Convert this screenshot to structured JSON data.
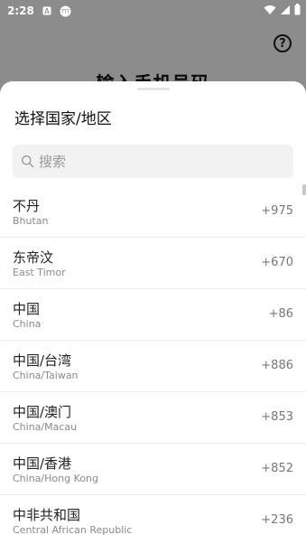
{
  "status_bar": {
    "time": "2:28",
    "icons": [
      "notification-a-icon",
      "notification-ttt-icon",
      "wifi-icon",
      "signal-icon",
      "battery-icon"
    ]
  },
  "background": {
    "title": "输入手机号码"
  },
  "sheet": {
    "title": "选择国家/地区",
    "search": {
      "placeholder": "搜索"
    },
    "countries": [
      {
        "name": "不丹",
        "english": "Bhutan",
        "code": "+975"
      },
      {
        "name": "东帝汶",
        "english": "East Timor",
        "code": "+670"
      },
      {
        "name": "中国",
        "english": "China",
        "code": "+86"
      },
      {
        "name": "中国/台湾",
        "english": "China/Taiwan",
        "code": "+886"
      },
      {
        "name": "中国/澳门",
        "english": "China/Macau",
        "code": "+853"
      },
      {
        "name": "中国/香港",
        "english": "China/Hong Kong",
        "code": "+852"
      },
      {
        "name": "中非共和国",
        "english": "Central African Republic",
        "code": "+236"
      }
    ]
  }
}
